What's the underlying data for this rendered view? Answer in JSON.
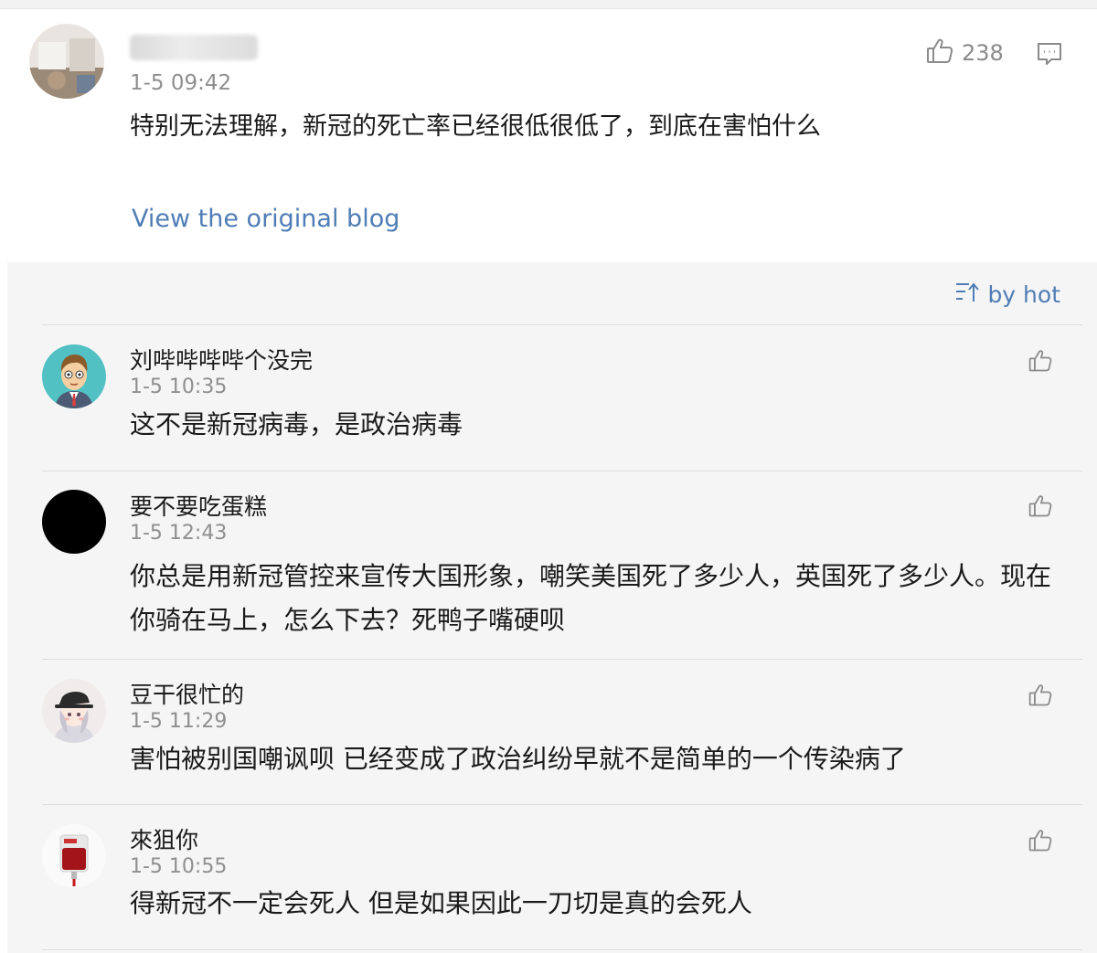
{
  "post": {
    "username": "",
    "time": "1-5 09:42",
    "text": "特别无法理解，新冠的死亡率已经很低很低了，到底在害怕什么",
    "like_count": "238",
    "view_original_label": "View the original blog"
  },
  "sort": {
    "label": "by hot"
  },
  "colors": {
    "link": "#4f7db5",
    "panel_bg": "#f5f5f5",
    "meta_gray": "#8f8f8f"
  },
  "icons": {
    "like": "thumbs-up-icon",
    "comment": "comment-bubble-icon",
    "sort": "sort-lines-arrow-icon"
  },
  "comments": [
    {
      "username": "刘哔哔哔哔个没完",
      "time": "1-5 10:35",
      "text": "这不是新冠病毒，是政治病毒"
    },
    {
      "username": "要不要吃蛋糕",
      "time": "1-5 12:43",
      "text": "你总是用新冠管控来宣传大国形象，嘲笑美国死了多少人，英国死了多少人。现在你骑在马上，怎么下去？死鸭子嘴硬呗"
    },
    {
      "username": "豆干很忙的",
      "time": "1-5 11:29",
      "text": "害怕被别国嘲讽呗 已经变成了政治纠纷早就不是简单的一个传染病了"
    },
    {
      "username": "來狙你",
      "time": "1-5 10:55",
      "text": "得新冠不一定会死人 但是如果因此一刀切是真的会死人"
    }
  ]
}
